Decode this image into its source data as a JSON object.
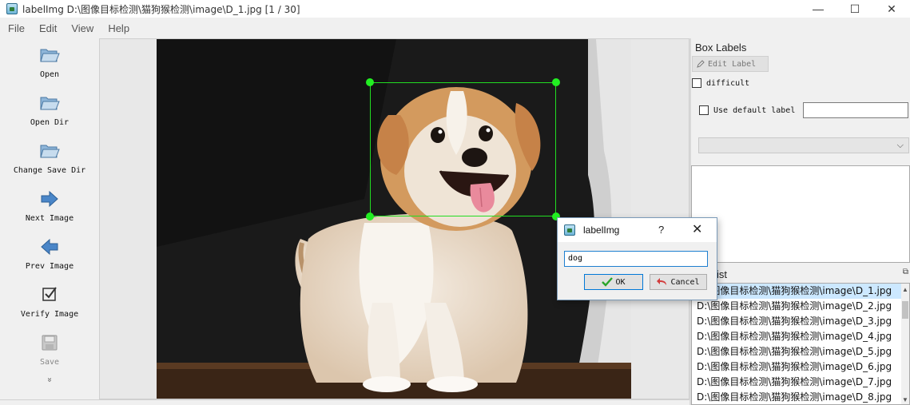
{
  "window": {
    "title": "labelImg D:\\图像目标检测\\猫狗猴检测\\image\\D_1.jpg [1 / 30]",
    "minimize": "—",
    "maximize": "☐",
    "close": "✕"
  },
  "menu": [
    "File",
    "Edit",
    "View",
    "Help"
  ],
  "toolbar": {
    "items": [
      {
        "label": "Open",
        "icon": "folder-open-icon"
      },
      {
        "label": "Open Dir",
        "icon": "folder-open-icon"
      },
      {
        "label": "Change Save Dir",
        "icon": "folder-open-icon"
      },
      {
        "label": "Next Image",
        "icon": "arrow-right-icon"
      },
      {
        "label": "Prev Image",
        "icon": "arrow-left-icon"
      },
      {
        "label": "Verify Image",
        "icon": "checkbox-icon"
      },
      {
        "label": "Save",
        "icon": "save-icon"
      }
    ],
    "more": "»"
  },
  "box_labels": {
    "title": "Box Labels",
    "edit_label": "Edit Label",
    "difficult": "difficult",
    "use_default_label": "Use default label",
    "default_label_value": ""
  },
  "file_list": {
    "title": "ist",
    "files": [
      "D:\\图像目标检测\\猫狗猴检测\\image\\D_1.jpg",
      "D:\\图像目标检测\\猫狗猴检测\\image\\D_2.jpg",
      "D:\\图像目标检测\\猫狗猴检测\\image\\D_3.jpg",
      "D:\\图像目标检测\\猫狗猴检测\\image\\D_4.jpg",
      "D:\\图像目标检测\\猫狗猴检测\\image\\D_5.jpg",
      "D:\\图像目标检测\\猫狗猴检测\\image\\D_6.jpg",
      "D:\\图像目标检测\\猫狗猴检测\\image\\D_7.jpg",
      "D:\\图像目标检测\\猫狗猴检测\\image\\D_8.jpg"
    ],
    "selected_index": 0
  },
  "dialog": {
    "title": "labelImg",
    "help": "?",
    "close": "✕",
    "input_value": "dog",
    "ok_label": "OK",
    "cancel_label": "Cancel"
  },
  "colors": {
    "bbox": "#22dd22",
    "selection": "#cce8ff",
    "focus": "#0078d7"
  }
}
